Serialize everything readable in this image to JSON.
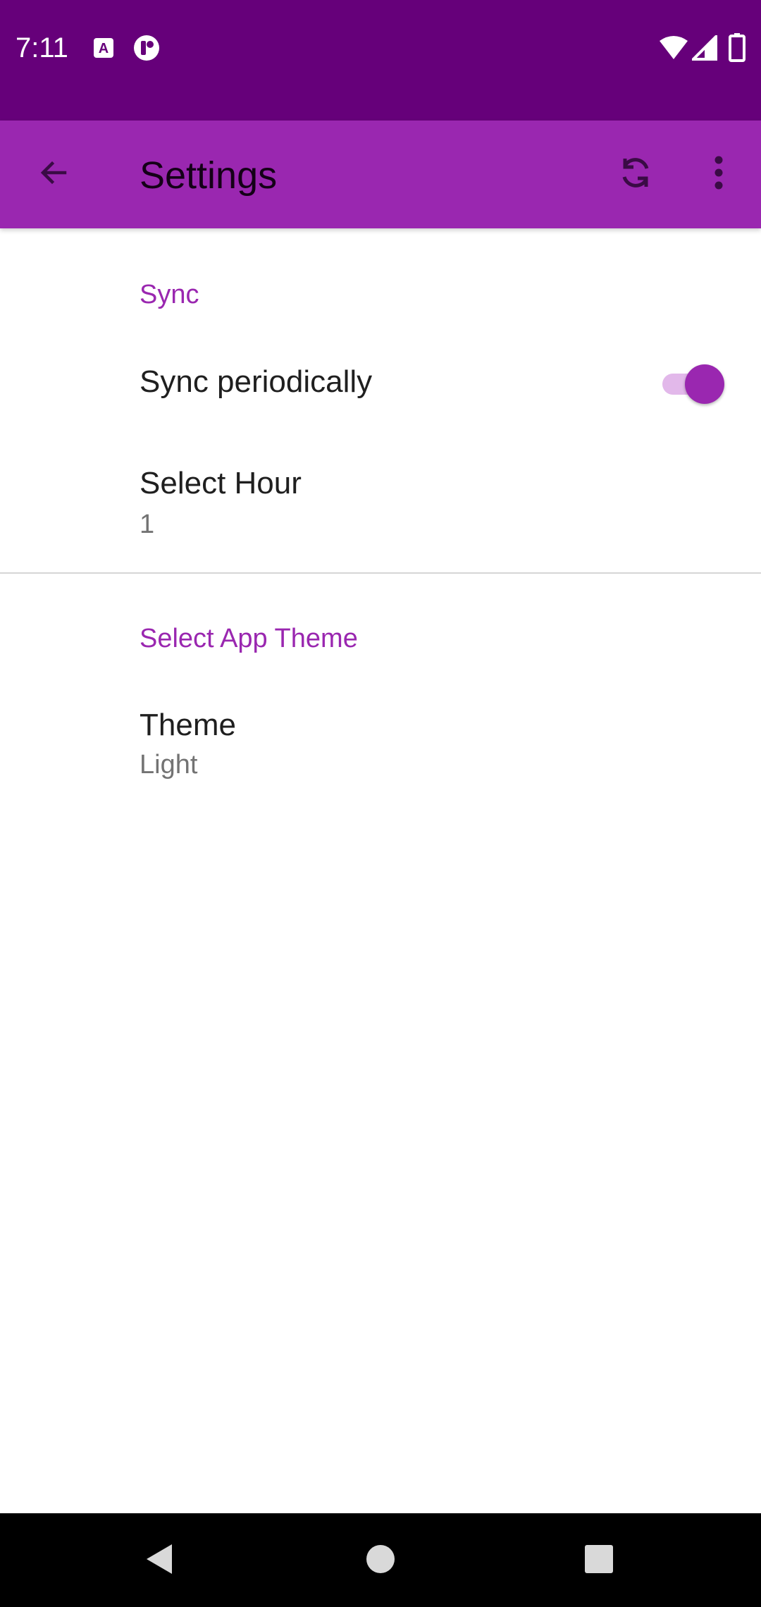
{
  "status_bar": {
    "time": "7:11",
    "notification_icons": [
      "accessibility-a-icon",
      "app-notification-icon"
    ],
    "system_icons": [
      "wifi-icon",
      "signal-icon",
      "battery-icon"
    ]
  },
  "app_bar": {
    "title": "Settings",
    "back_icon": "arrow-back-icon",
    "actions": [
      "sync-icon",
      "more-vert-icon"
    ]
  },
  "sections": {
    "sync": {
      "header": "Sync",
      "sync_periodically": {
        "title": "Sync periodically",
        "enabled": true
      },
      "select_hour": {
        "title": "Select Hour",
        "summary": "1"
      }
    },
    "theme": {
      "header": "Select App Theme",
      "theme_pref": {
        "title": "Theme",
        "summary": "Light"
      }
    }
  },
  "nav_bar": {
    "buttons": [
      "back-triangle-icon",
      "home-circle-icon",
      "recents-square-icon"
    ]
  },
  "colors": {
    "status_bar": "#66007a",
    "app_bar": "#9a27b0",
    "accent": "#9a27b0",
    "switch_track": "#e2b8ea",
    "nav_bar": "#000000"
  }
}
